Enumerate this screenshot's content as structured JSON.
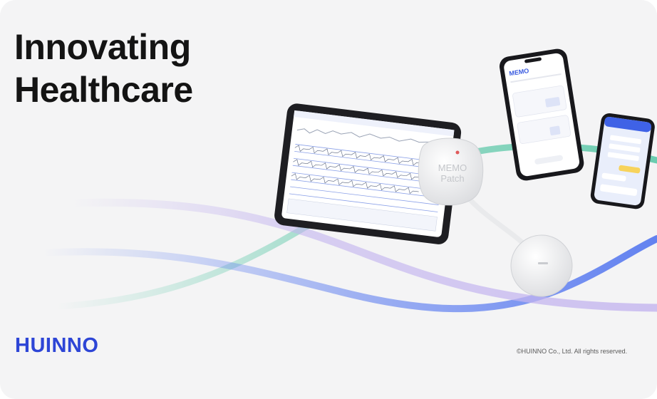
{
  "headline": {
    "line1": "Innovating",
    "line2": "Healthcare"
  },
  "brand": {
    "name": "HUINNO",
    "color": "#2d45d6"
  },
  "footer": {
    "copyright": "©HUINNO Co., Ltd. All rights reserved."
  },
  "devices": {
    "patch_label_line1": "MEMO",
    "patch_label_line2": "Patch",
    "phone_app_title": "MEMO"
  },
  "colors": {
    "background": "#f4f4f5",
    "wave_green": "#5cc8a8",
    "wave_blue": "#5b7cf0",
    "wave_lavender": "#c3b4ef"
  },
  "icons": [
    "memo-patch-device",
    "tablet-device",
    "smartphone-device"
  ]
}
